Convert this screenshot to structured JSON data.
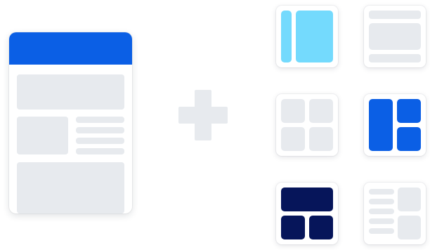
{
  "illustration": {
    "colors": {
      "header_blue": "#0b5fe5",
      "placeholder_gray": "#e7eaee",
      "sky_blue": "#74dafd",
      "navy": "#06155a",
      "card_background": "#ffffff"
    },
    "base_page": {
      "icon": "page-mockup-icon"
    },
    "operator": {
      "icon": "plus-icon"
    },
    "layout_options": [
      {
        "name": "sidebar-with-content",
        "accent": "sky_blue"
      },
      {
        "name": "stacked-rows",
        "accent": "placeholder_gray"
      },
      {
        "name": "two-by-two-grid",
        "accent": "placeholder_gray"
      },
      {
        "name": "tall-left-split-right",
        "accent": "header_blue"
      },
      {
        "name": "wide-top-split-bottom",
        "accent": "navy"
      },
      {
        "name": "text-lines-with-blocks",
        "accent": "placeholder_gray"
      }
    ]
  }
}
